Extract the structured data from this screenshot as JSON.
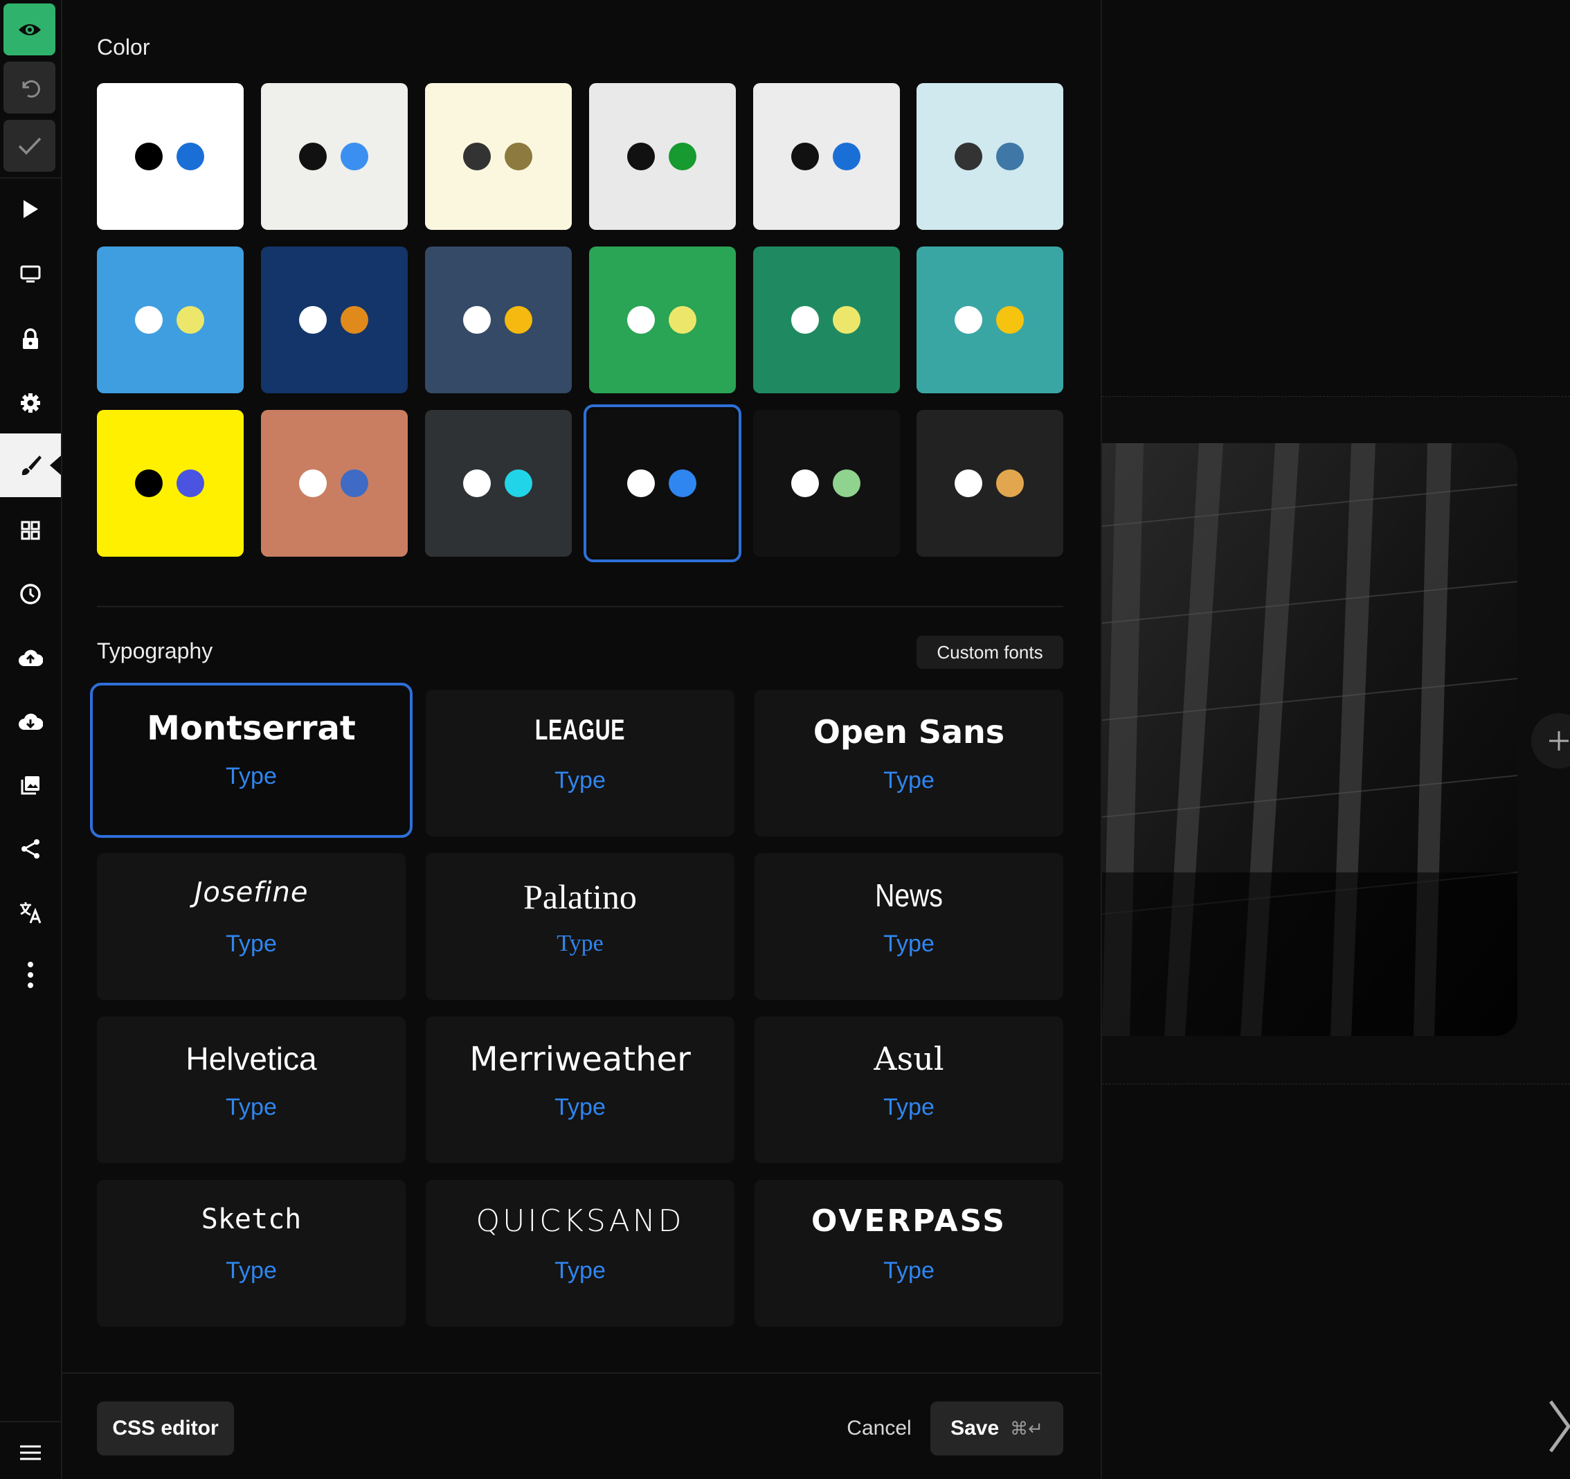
{
  "sections": {
    "color_title": "Color",
    "typography_title": "Typography",
    "custom_fonts_label": "Custom fonts"
  },
  "color_themes": [
    {
      "bg": "#ffffff",
      "dot1": "#000000",
      "dot2": "#1a6fd6"
    },
    {
      "bg": "#efefeb",
      "dot1": "#111111",
      "dot2": "#3b8ff0"
    },
    {
      "bg": "#fbf7df",
      "dot1": "#333333",
      "dot2": "#8c7a3e"
    },
    {
      "bg": "#e9e9e9",
      "dot1": "#111111",
      "dot2": "#179a2f"
    },
    {
      "bg": "#ececec",
      "dot1": "#111111",
      "dot2": "#1a6fd6"
    },
    {
      "bg": "#cfe9ef",
      "dot1": "#333333",
      "dot2": "#3f78a6"
    },
    {
      "bg": "#3f9ee0",
      "dot1": "#ffffff",
      "dot2": "#ece76a"
    },
    {
      "bg": "#133569",
      "dot1": "#ffffff",
      "dot2": "#e08a1c"
    },
    {
      "bg": "#344a66",
      "dot1": "#ffffff",
      "dot2": "#f6b90f"
    },
    {
      "bg": "#2aa455",
      "dot1": "#ffffff",
      "dot2": "#ece76a"
    },
    {
      "bg": "#1f8a62",
      "dot1": "#ffffff",
      "dot2": "#ece76a"
    },
    {
      "bg": "#3aa6a4",
      "dot1": "#ffffff",
      "dot2": "#f6c40f"
    },
    {
      "bg": "#fff000",
      "dot1": "#000000",
      "dot2": "#4a54e0"
    },
    {
      "bg": "#c97e62",
      "dot1": "#ffffff",
      "dot2": "#3f6bc4"
    },
    {
      "bg": "#2f3234",
      "dot1": "#ffffff",
      "dot2": "#22d4e8"
    },
    {
      "bg": "#0e0e0e",
      "dot1": "#ffffff",
      "dot2": "#2f86f0",
      "selected": true
    },
    {
      "bg": "#121212",
      "dot1": "#ffffff",
      "dot2": "#8fd38f"
    },
    {
      "bg": "#222222",
      "dot1": "#ffffff",
      "dot2": "#e2a74e"
    }
  ],
  "fonts": [
    {
      "name": "Montserrat",
      "type": "Type",
      "selected": true
    },
    {
      "name": "LEAGUE",
      "type": "Type"
    },
    {
      "name": "Open Sans",
      "type": "Type"
    },
    {
      "name": "Josefine",
      "type": "Type"
    },
    {
      "name": "Palatino",
      "type": "Type"
    },
    {
      "name": "News",
      "type": "Type"
    },
    {
      "name": "Helvetica",
      "type": "Type"
    },
    {
      "name": "Merriweather",
      "type": "Type"
    },
    {
      "name": "Asul",
      "type": "Type"
    },
    {
      "name": "Sketch",
      "type": "Type"
    },
    {
      "name": "QUICKSAND",
      "type": "Type"
    },
    {
      "name": "OVERPASS",
      "type": "Type"
    }
  ],
  "footer": {
    "css_editor": "CSS editor",
    "cancel": "Cancel",
    "save": "Save",
    "save_shortcut": "⌘↵"
  },
  "accent_color": "#2e6fd8",
  "brand_green": "#2fb26b"
}
